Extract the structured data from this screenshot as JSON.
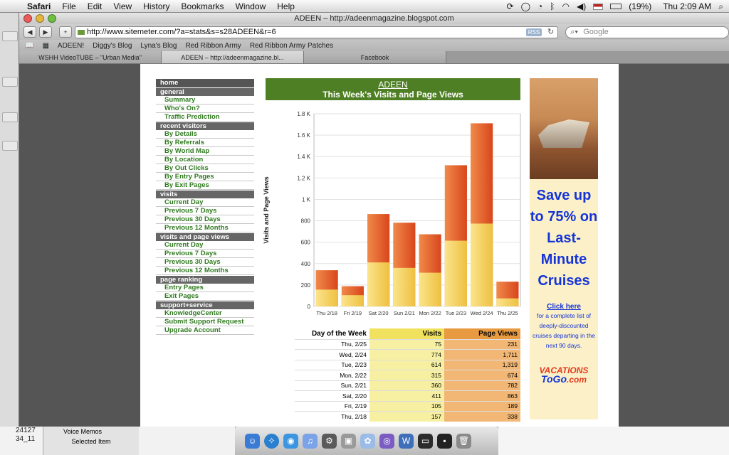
{
  "menubar": {
    "app": "Safari",
    "items": [
      "File",
      "Edit",
      "View",
      "History",
      "Bookmarks",
      "Window",
      "Help"
    ],
    "battery": "(19%)",
    "clock": "Thu 2:09 AM"
  },
  "window": {
    "title": "ADEEN – http://adeenmagazine.blogspot.com",
    "url": "http://www.sitemeter.com/?a=stats&s=s28ADEEN&r=6",
    "rss": "RSS",
    "search_placeholder": "Google"
  },
  "bookmarks": [
    "ADEEN!",
    "Diggy's Blog",
    "Lyna's Blog",
    "Red Ribbon Army",
    "Red Ribbon Army Patches"
  ],
  "tabs": [
    "WSHH VideoTUBE – \"Urban Media\"",
    "ADEEN – http://adeenmagazine.bl...",
    "Facebook"
  ],
  "nav": [
    {
      "type": "head",
      "label": "home",
      "home": true
    },
    {
      "type": "head",
      "label": "general"
    },
    {
      "type": "item",
      "label": "Summary"
    },
    {
      "type": "item",
      "label": "Who's On?"
    },
    {
      "type": "item",
      "label": "Traffic Prediction"
    },
    {
      "type": "head",
      "label": "recent visitors"
    },
    {
      "type": "item",
      "label": "By Details"
    },
    {
      "type": "item",
      "label": "By Referrals"
    },
    {
      "type": "item",
      "label": "By World Map"
    },
    {
      "type": "item",
      "label": "By Location"
    },
    {
      "type": "item",
      "label": "By Out Clicks"
    },
    {
      "type": "item",
      "label": "By Entry Pages"
    },
    {
      "type": "item",
      "label": "By Exit Pages"
    },
    {
      "type": "head",
      "label": "visits"
    },
    {
      "type": "item",
      "label": "Current Day"
    },
    {
      "type": "item",
      "label": "Previous 7 Days"
    },
    {
      "type": "item",
      "label": "Previous 30 Days"
    },
    {
      "type": "item",
      "label": "Previous 12 Months"
    },
    {
      "type": "head",
      "label": "visits and page views"
    },
    {
      "type": "item",
      "label": "Current Day"
    },
    {
      "type": "item",
      "label": "Previous 7 Days"
    },
    {
      "type": "item",
      "label": "Previous 30 Days"
    },
    {
      "type": "item",
      "label": "Previous 12 Months"
    },
    {
      "type": "head",
      "label": "page ranking"
    },
    {
      "type": "item",
      "label": "Entry Pages"
    },
    {
      "type": "item",
      "label": "Exit Pages"
    },
    {
      "type": "head",
      "label": "support+service"
    },
    {
      "type": "item",
      "label": "KnowledgeCenter"
    },
    {
      "type": "item",
      "label": "Submit Support Request"
    },
    {
      "type": "item",
      "label": "Upgrade Account"
    }
  ],
  "chart_header": {
    "site": "ADEEN",
    "title": "This Week's Visits and Page Views"
  },
  "chart_data": {
    "type": "bar",
    "ylabel": "Visits and Page Views",
    "ylim": [
      0,
      1800
    ],
    "yticks": [
      0,
      200,
      400,
      600,
      800,
      "1 K",
      "1.2 K",
      "1.4 K",
      "1.6 K",
      "1.8 K"
    ],
    "categories": [
      "Thu 2/18",
      "Fri 2/19",
      "Sat 2/20",
      "Sun 2/21",
      "Mon 2/22",
      "Tue 2/23",
      "Wed 2/24",
      "Thu 2/25"
    ],
    "series": [
      {
        "name": "Visits",
        "values": [
          157,
          105,
          411,
          360,
          315,
          614,
          774,
          75
        ],
        "color": "#f2cc45"
      },
      {
        "name": "Page Views",
        "values": [
          338,
          189,
          863,
          782,
          674,
          1319,
          1711,
          231
        ],
        "color": "#e25a26"
      }
    ]
  },
  "table": {
    "headers": [
      "Day of the Week",
      "Visits",
      "Page Views"
    ],
    "rows": [
      [
        "Thu, 2/25",
        "75",
        "231"
      ],
      [
        "Wed, 2/24",
        "774",
        "1,711"
      ],
      [
        "Tue, 2/23",
        "614",
        "1,319"
      ],
      [
        "Mon, 2/22",
        "315",
        "674"
      ],
      [
        "Sun, 2/21",
        "360",
        "782"
      ],
      [
        "Sat, 2/20",
        "411",
        "863"
      ],
      [
        "Fri, 2/19",
        "105",
        "189"
      ],
      [
        "Thu, 2/18",
        "157",
        "338"
      ]
    ]
  },
  "ad": {
    "headline": "Save up to 75% on Last-Minute Cruises",
    "click": "Click here",
    "sub": "for a complete list of deeply-discounted cruises departing in the next 90 days.",
    "logo_a": "VACATIONS",
    "logo_b": "ToGo",
    "logo_c": ".com"
  },
  "bottom": {
    "nums": [
      "24127",
      "34_11"
    ],
    "panel": [
      "Voice Memos",
      "Selected Item"
    ]
  }
}
